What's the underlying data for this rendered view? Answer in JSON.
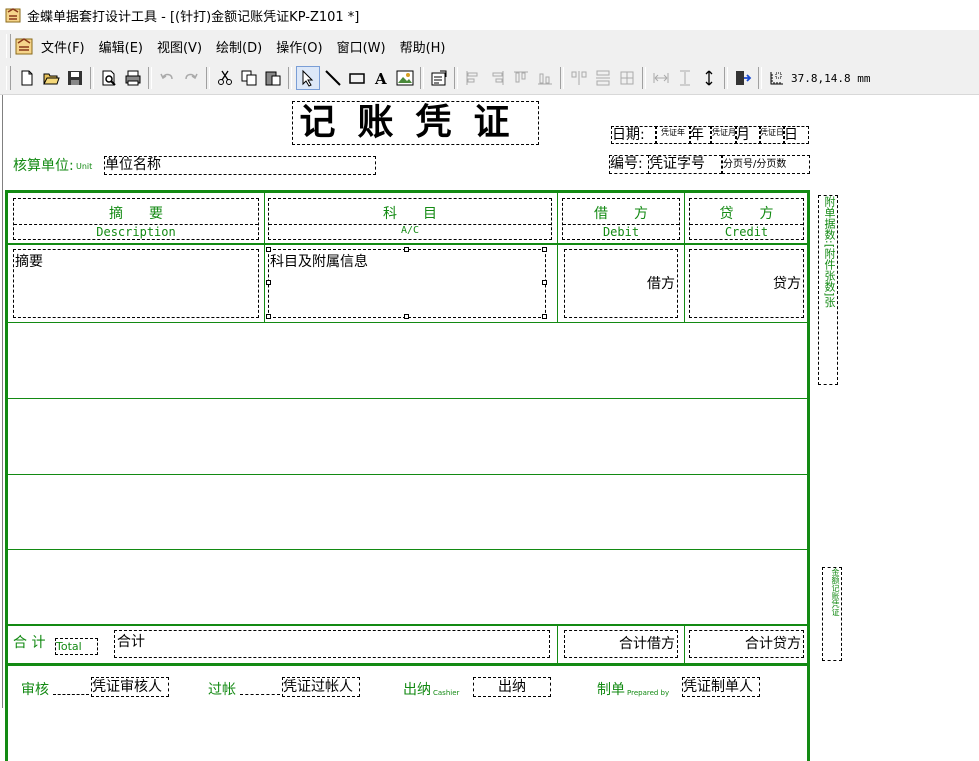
{
  "window": {
    "title": "金蝶单据套打设计工具 - [(针打)金额记账凭证KP-Z101 *]"
  },
  "menu": {
    "file": "文件(F)",
    "edit": "编辑(E)",
    "view": "视图(V)",
    "draw": "绘制(D)",
    "operate": "操作(O)",
    "window": "窗口(W)",
    "help": "帮助(H)"
  },
  "toolbar": {
    "coords": "37.8,14.8 mm"
  },
  "voucher": {
    "title": "记账凭证",
    "date_label": "日期:",
    "date_field": "凭证年",
    "year": "年",
    "month_field": "凭证月",
    "month": "月",
    "day_field": "凭证日",
    "day": "日",
    "unit_label": "核算单位:",
    "unit_en": "Unit",
    "unit_value": "单位名称",
    "number_label": "编号:",
    "number_value": "凭证字号",
    "page_value": "分页号/分页数",
    "col_summary_cn": "摘要",
    "col_summary_en": "Description",
    "col_account_cn": "科目",
    "col_account_en": "A/C",
    "col_debit_cn": "借方",
    "col_debit_en": "Debit",
    "col_credit_cn": "贷方",
    "col_credit_en": "Credit",
    "cell_summary": "摘要",
    "cell_account": "科目及附属信息",
    "cell_debit": "借方",
    "cell_credit": "贷方",
    "total_label": "合 计",
    "total_en": "Total",
    "total_value": "合计",
    "total_debit": "合计借方",
    "total_credit": "合计贷方",
    "side_attach": "附单据数:[附件张数]张",
    "side_amount": "金额记账凭证",
    "audit_label": "审核",
    "audit_value": "凭证审核人",
    "post_label": "过帐",
    "post_value": "凭证过帐人",
    "cashier_label": "出纳",
    "cashier_en": "Cashier",
    "cashier_value": "出纳",
    "maker_label": "制单",
    "maker_en": "Prepared by",
    "maker_value": "凭证制单人"
  }
}
